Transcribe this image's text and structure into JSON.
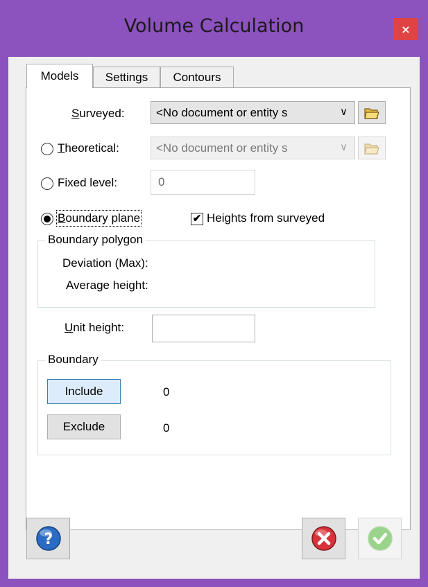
{
  "window": {
    "title": "Volume Calculation",
    "close_glyph": "×"
  },
  "tabs": [
    {
      "label": "Models",
      "active": true
    },
    {
      "label": "Settings",
      "active": false
    },
    {
      "label": "Contours",
      "active": false
    }
  ],
  "models": {
    "surveyed": {
      "label_u": "S",
      "label_rest": "urveyed:",
      "value": "<No document or entity s",
      "chevron": "∨"
    },
    "theoretical": {
      "label_u": "T",
      "label_rest": "heoretical:",
      "value": "<No document or entity s",
      "chevron": "∨",
      "selected": false
    },
    "fixed_level": {
      "label": "Fixed level:",
      "value": "0",
      "selected": false
    },
    "boundary_plane": {
      "label_u": "B",
      "label_rest": "oundary plane",
      "selected": true
    },
    "heights_from_surveyed": {
      "label": "Heights from surveyed",
      "checked": true,
      "check_glyph": "✔"
    },
    "boundary_polygon": {
      "title": "Boundary polygon",
      "deviation_label": "Deviation (Max):",
      "average_height_label": "Average height:"
    },
    "unit_height": {
      "label_u": "U",
      "label_rest": "nit height:",
      "value": ""
    },
    "boundary": {
      "title": "Boundary",
      "include_label": "Include",
      "include_count": "0",
      "exclude_label": "Exclude",
      "exclude_count": "0"
    }
  },
  "footer": {
    "help_icon": "help-icon",
    "cancel_icon": "cancel-icon",
    "ok_icon": "ok-icon"
  },
  "colors": {
    "title_bar": "#8c52bd",
    "close_button": "#e04343",
    "help_blue": "#2a6cc4",
    "cancel_red": "#d8333a",
    "ok_green": "#7cc96a"
  }
}
